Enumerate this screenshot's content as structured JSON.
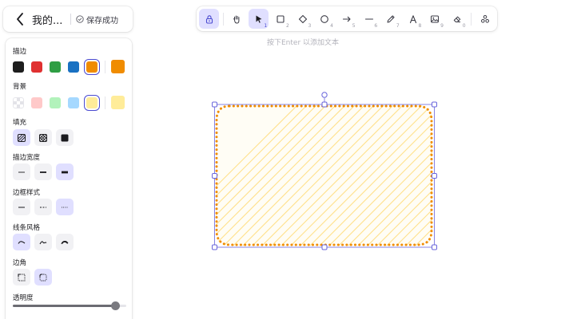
{
  "header": {
    "title": "我的...",
    "save_status": "保存成功"
  },
  "toolbar": {
    "tools": [
      {
        "name": "lock",
        "key": "",
        "active": true
      },
      {
        "name": "hand",
        "key": "",
        "active": false
      },
      {
        "name": "selection",
        "key": "1",
        "active": true
      },
      {
        "name": "rectangle",
        "key": "2",
        "active": false
      },
      {
        "name": "diamond",
        "key": "3",
        "active": false
      },
      {
        "name": "ellipse",
        "key": "4",
        "active": false
      },
      {
        "name": "arrow",
        "key": "5",
        "active": false
      },
      {
        "name": "line",
        "key": "6",
        "active": false
      },
      {
        "name": "draw",
        "key": "7",
        "active": false
      },
      {
        "name": "text",
        "key": "8",
        "active": false
      },
      {
        "name": "image",
        "key": "9",
        "active": false
      },
      {
        "name": "eraser",
        "key": "0",
        "active": false
      },
      {
        "name": "more-tools",
        "key": "",
        "active": false
      }
    ],
    "hint": "按下Enter 以添加文本"
  },
  "panel": {
    "stroke": {
      "label": "描边",
      "colors": [
        "#1e1e1e",
        "#e03131",
        "#2f9e44",
        "#1971c2",
        "#f08c00"
      ],
      "selected_index": 4,
      "current": "#f08c00"
    },
    "background": {
      "label": "背景",
      "colors": [
        "transparent",
        "#ffc9c9",
        "#b2f2bb",
        "#a5d8ff",
        "#ffec99"
      ],
      "selected_index": 4,
      "current": "#ffec99"
    },
    "fill": {
      "label": "填充",
      "options": [
        "hachure",
        "cross-hatch",
        "solid"
      ],
      "selected_index": 0
    },
    "stroke_width": {
      "label": "描边宽度",
      "options": [
        "thin",
        "bold",
        "extra-bold"
      ],
      "selected_index": 2
    },
    "stroke_style": {
      "label": "边框样式",
      "options": [
        "solid",
        "dashed",
        "dotted"
      ],
      "selected_index": 2
    },
    "sloppiness": {
      "label": "线条风格",
      "options": [
        "architect",
        "artist",
        "cartoonist"
      ],
      "selected_index": 0
    },
    "edges": {
      "label": "边角",
      "options": [
        "sharp",
        "round"
      ],
      "selected_index": 1
    },
    "opacity": {
      "label": "透明度",
      "value": 100
    }
  },
  "canvas": {
    "shape": {
      "type": "rectangle",
      "stroke": "#f08c00",
      "fill": "#ffec99",
      "fill_style": "hachure",
      "stroke_style": "dotted",
      "edges": "round",
      "selected": true
    }
  },
  "colors": {
    "accent": "#4a4ad0",
    "accent_light": "#e0dfff",
    "selection": "#6965db"
  }
}
